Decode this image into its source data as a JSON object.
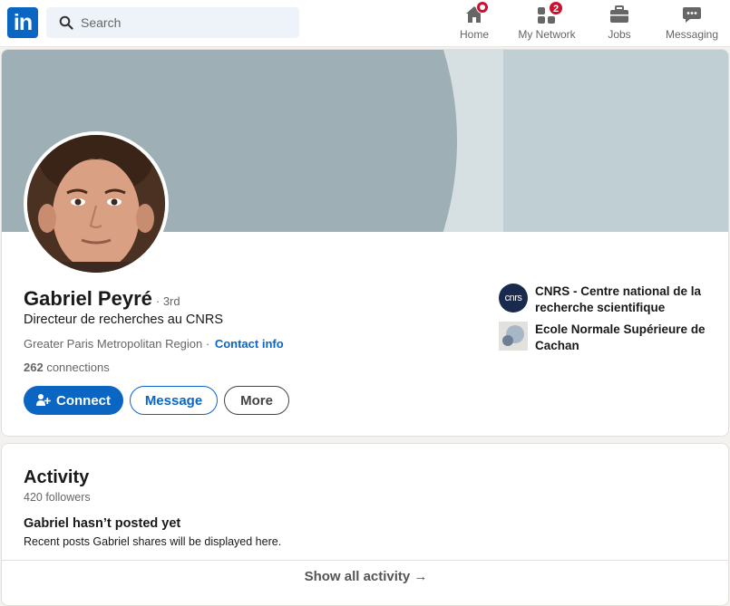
{
  "nav": {
    "logo_text": "in",
    "search_placeholder": "Search",
    "items": [
      {
        "label": "Home",
        "icon": "home-icon",
        "badge": ""
      },
      {
        "label": "My Network",
        "icon": "network-icon",
        "badge": "2"
      },
      {
        "label": "Jobs",
        "icon": "briefcase-icon",
        "badge": ""
      },
      {
        "label": "Messaging",
        "icon": "message-icon",
        "badge": ""
      }
    ]
  },
  "profile": {
    "name": "Gabriel Peyré",
    "degree": "· 3rd",
    "headline": "Directeur de recherches au CNRS",
    "location": "Greater Paris Metropolitan Region ·",
    "contact_info": "Contact info",
    "connections_count": "262",
    "connections_label": "connections",
    "buttons": {
      "connect": "Connect",
      "message": "Message",
      "more": "More"
    },
    "organizations": [
      {
        "name": "CNRS - Centre national de la recherche scientifique",
        "logo_text": "cnrs"
      },
      {
        "name": "Ecole Normale Supérieure de Cachan",
        "logo_text": ""
      }
    ]
  },
  "activity": {
    "title": "Activity",
    "followers": "420 followers",
    "empty_title": "Gabriel hasn’t posted yet",
    "empty_subtitle": "Recent posts Gabriel shares will be displayed here.",
    "show_all": "Show all activity →"
  },
  "colors": {
    "brand": "#0a66c2",
    "badge": "#cb112d",
    "banner_dark": "#9eb0b5",
    "banner_light": "#d6e0e3"
  }
}
